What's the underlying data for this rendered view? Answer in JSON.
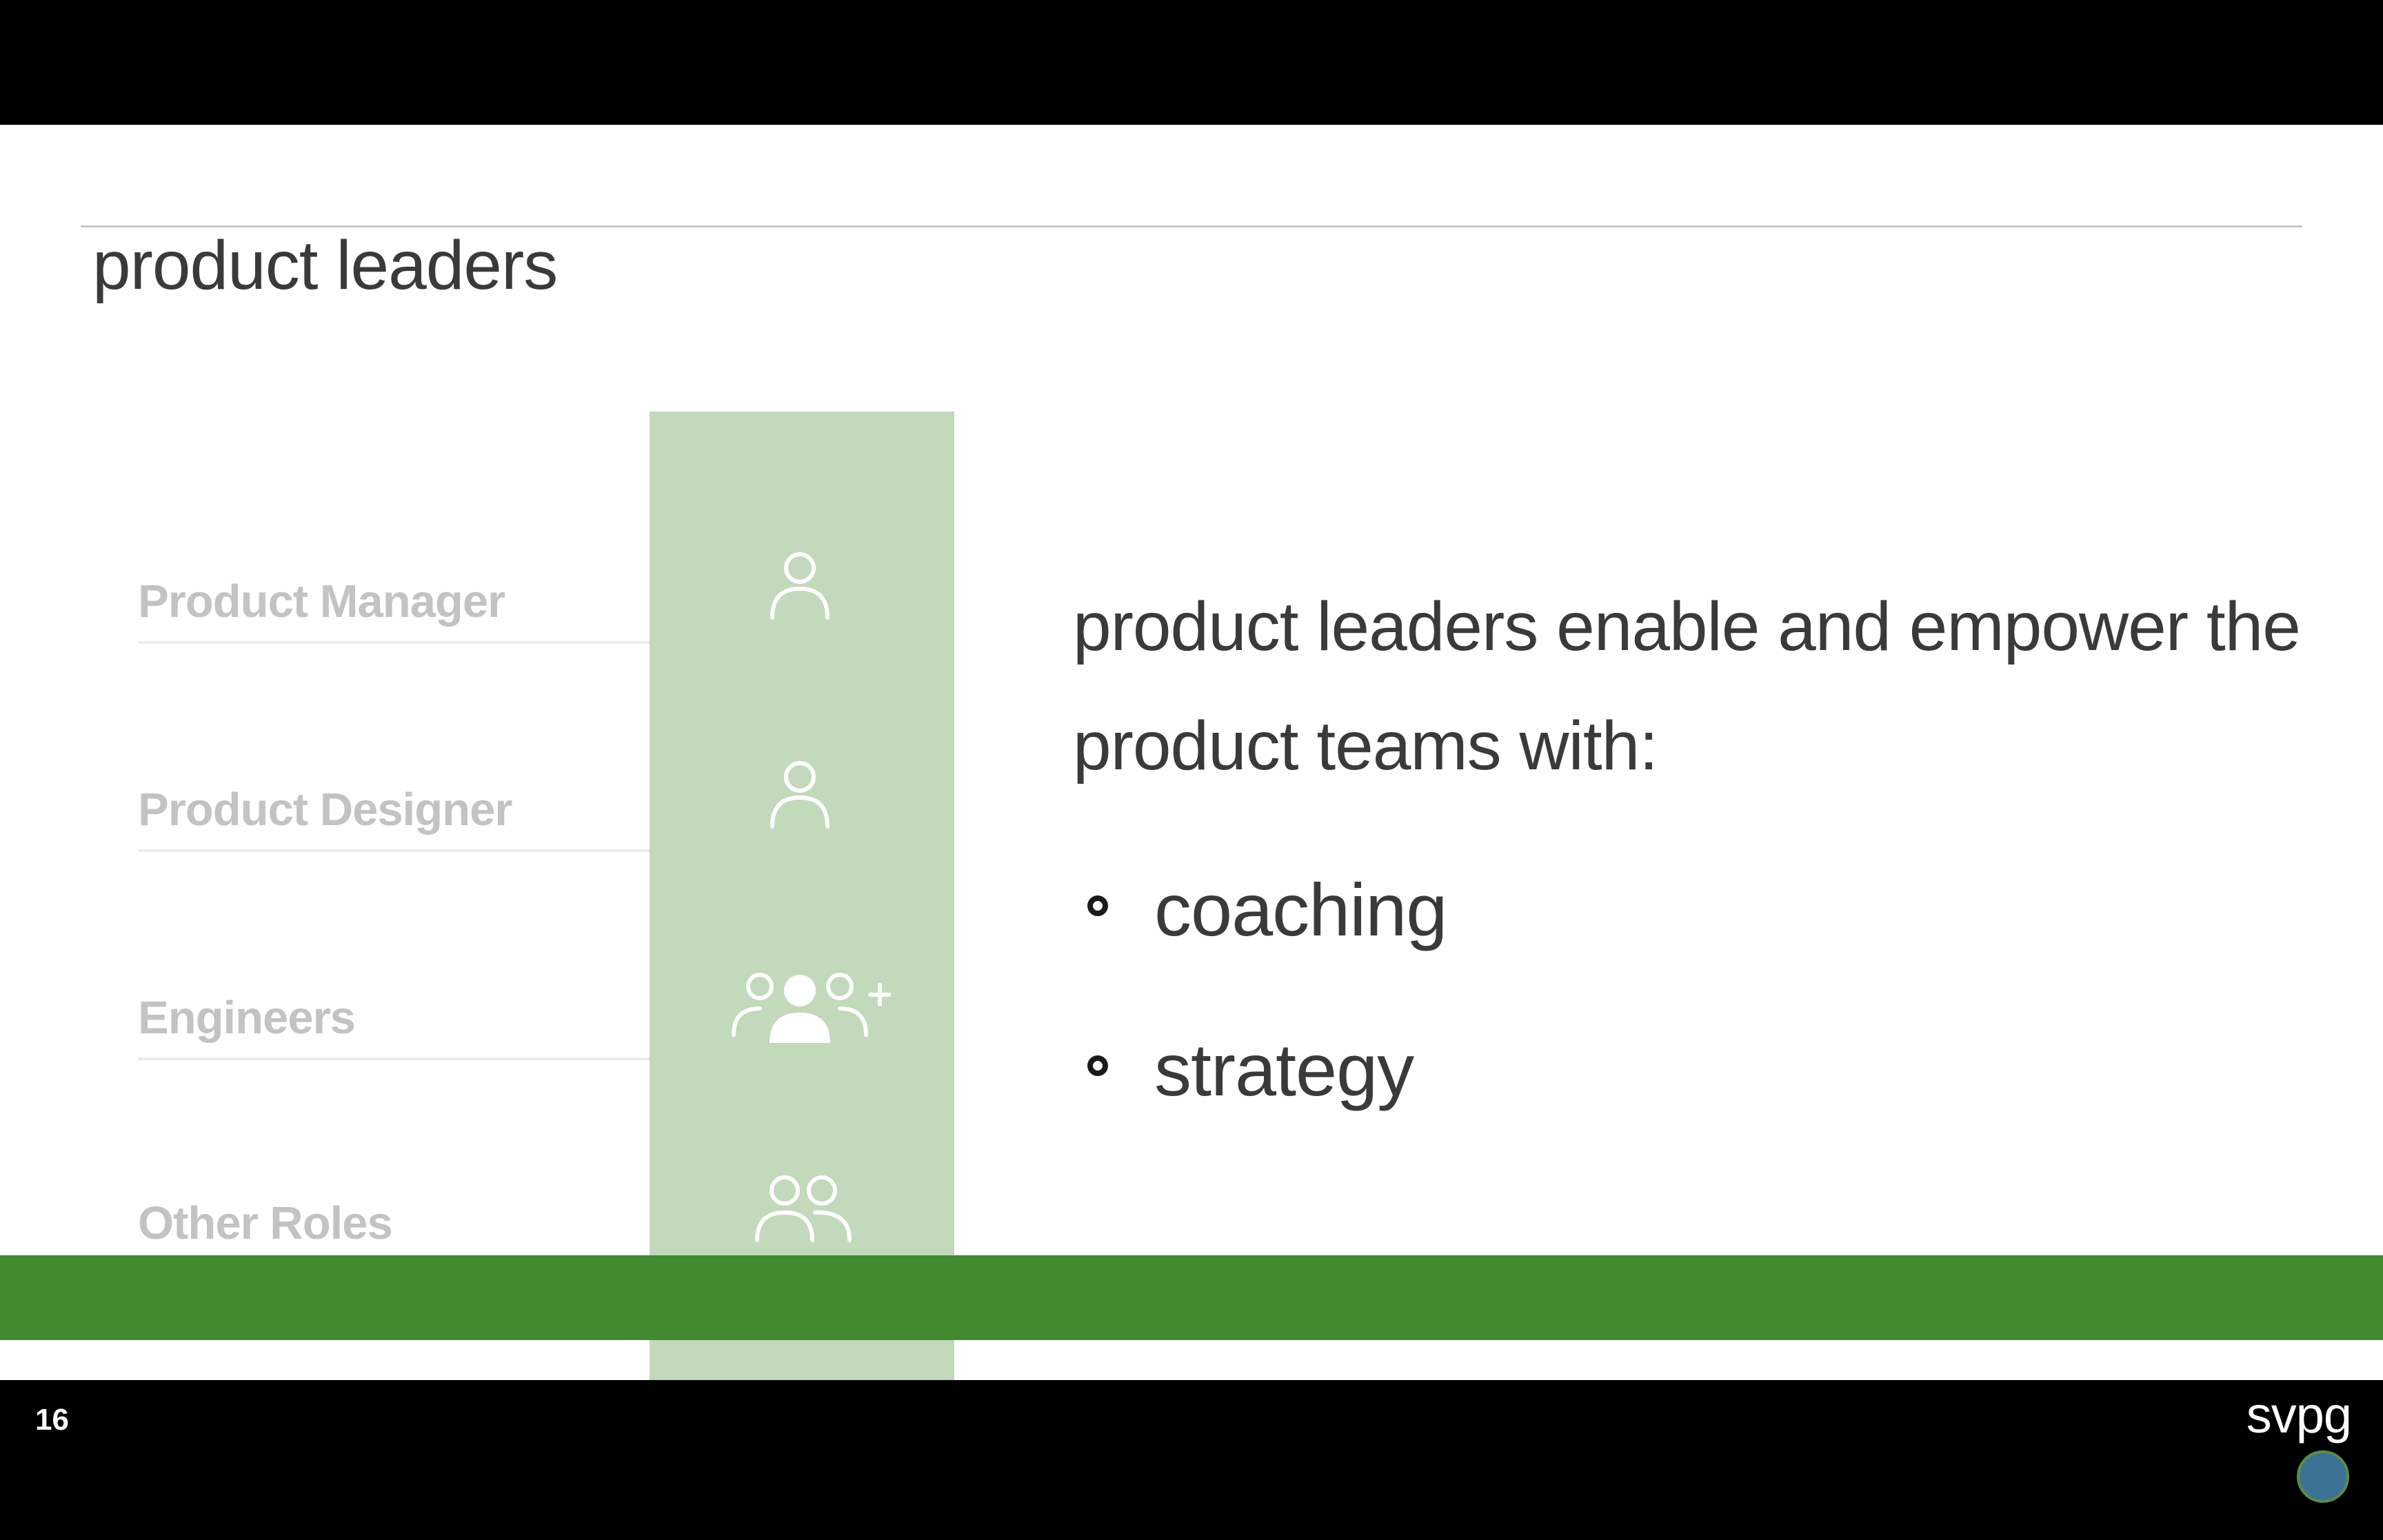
{
  "slide": {
    "title": "product leaders",
    "roles": [
      {
        "label": "Product Manager",
        "icon": "person-icon"
      },
      {
        "label": "Product Designer",
        "icon": "person-icon"
      },
      {
        "label": "Engineers",
        "icon": "group-add-icon"
      },
      {
        "label": "Other Roles",
        "icon": "people-icon"
      }
    ],
    "body": "product leaders enable and empower the product teams with:",
    "bullets": [
      "coaching",
      "strategy"
    ],
    "page_number": "16",
    "brand": "svpg"
  },
  "colors": {
    "accent_green": "#418a2f",
    "column_green": "#c2d9bc",
    "role_label_gray": "#c3c3c3",
    "text_dark": "#3a3a3a",
    "background": "#ffffff",
    "letterbox": "#000000"
  }
}
